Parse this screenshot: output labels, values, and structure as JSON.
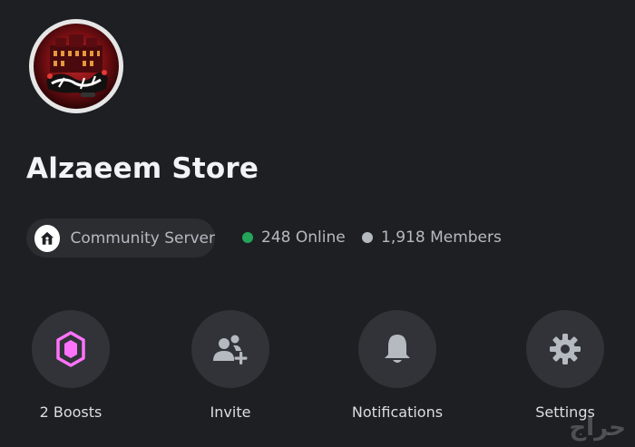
{
  "server": {
    "name": "Alzaeem Store",
    "icon": "server-logo-image"
  },
  "community": {
    "label": "Community Server",
    "icon": "home-icon"
  },
  "stats": {
    "online": "248 Online",
    "online_color": "#23a55a",
    "members": "1,918 Members",
    "members_color": "#b5bac1"
  },
  "actions": [
    {
      "label": "2 Boosts",
      "icon": "boost-gem-icon",
      "accent": "#ff73fa"
    },
    {
      "label": "Invite",
      "icon": "add-user-icon",
      "accent": "#b5bac1"
    },
    {
      "label": "Notifications",
      "icon": "bell-icon",
      "accent": "#b5bac1"
    },
    {
      "label": "Settings",
      "icon": "gear-icon",
      "accent": "#b5bac1"
    }
  ],
  "watermark": "حراج"
}
